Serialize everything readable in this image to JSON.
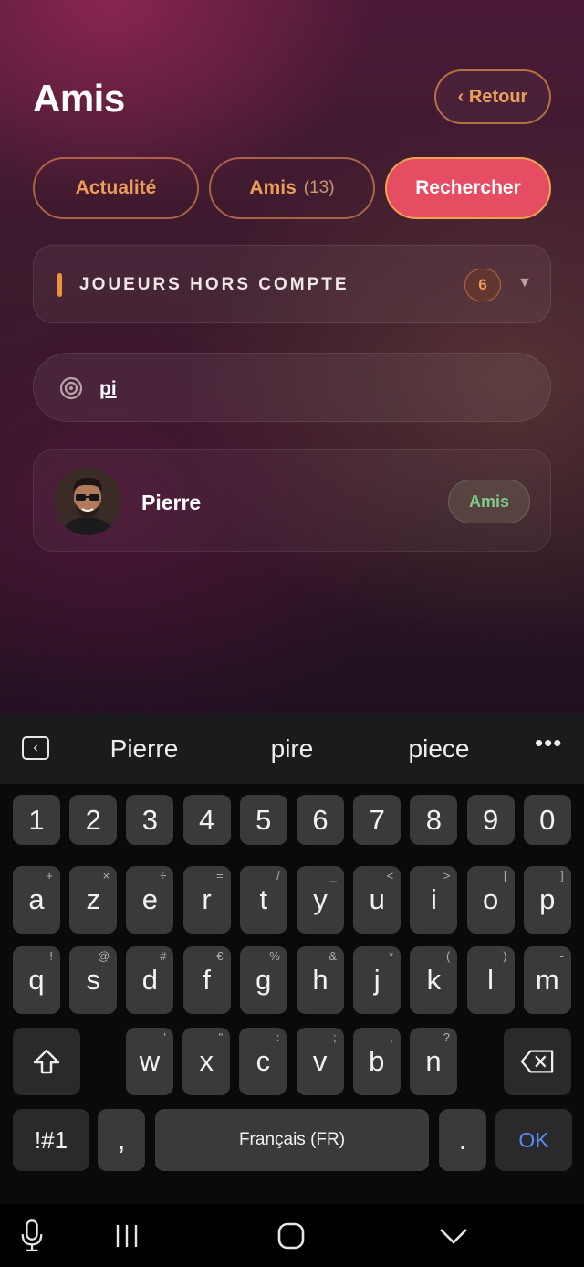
{
  "header": {
    "title": "Amis",
    "back_label": "‹ Retour"
  },
  "tabs": [
    {
      "label": "Actualité"
    },
    {
      "label": "Amis",
      "count": "(13)"
    },
    {
      "label": "Rechercher",
      "active": true
    }
  ],
  "section": {
    "label": "JOUEURS HORS COMPTE",
    "count": "6",
    "chevron": "▼"
  },
  "search": {
    "value": "pi",
    "icon": "target-icon"
  },
  "results": [
    {
      "name": "Pierre",
      "status": "Amis",
      "avatar": "avatar-photo"
    }
  ],
  "keyboard": {
    "suggestions": [
      "Pierre",
      "pire",
      "piece"
    ],
    "more": "•••",
    "row_numbers": [
      "1",
      "2",
      "3",
      "4",
      "5",
      "6",
      "7",
      "8",
      "9",
      "0"
    ],
    "row1": [
      {
        "k": "a",
        "s": "+"
      },
      {
        "k": "z",
        "s": "×"
      },
      {
        "k": "e",
        "s": "÷"
      },
      {
        "k": "r",
        "s": "="
      },
      {
        "k": "t",
        "s": "/"
      },
      {
        "k": "y",
        "s": "_"
      },
      {
        "k": "u",
        "s": "<"
      },
      {
        "k": "i",
        "s": ">"
      },
      {
        "k": "o",
        "s": "["
      },
      {
        "k": "p",
        "s": "]"
      }
    ],
    "row2": [
      {
        "k": "q",
        "s": "!"
      },
      {
        "k": "s",
        "s": "@"
      },
      {
        "k": "d",
        "s": "#"
      },
      {
        "k": "f",
        "s": "€"
      },
      {
        "k": "g",
        "s": "%"
      },
      {
        "k": "h",
        "s": "&"
      },
      {
        "k": "j",
        "s": "*"
      },
      {
        "k": "k",
        "s": "("
      },
      {
        "k": "l",
        "s": ")"
      },
      {
        "k": "m",
        "s": "-"
      }
    ],
    "row3": [
      {
        "k": "w",
        "s": "'"
      },
      {
        "k": "x",
        "s": "\""
      },
      {
        "k": "c",
        "s": ":"
      },
      {
        "k": "v",
        "s": ";"
      },
      {
        "k": "b",
        "s": ","
      },
      {
        "k": "n",
        "s": "?"
      }
    ],
    "sym_label": "!#1",
    "comma": ",",
    "space_label": "Français (FR)",
    "period": ".",
    "ok_label": "OK"
  },
  "colors": {
    "accent": "#e64d62",
    "orange": "#ec9c59",
    "friend_green": "#7ec98d",
    "ok_blue": "#5a8cf0"
  }
}
